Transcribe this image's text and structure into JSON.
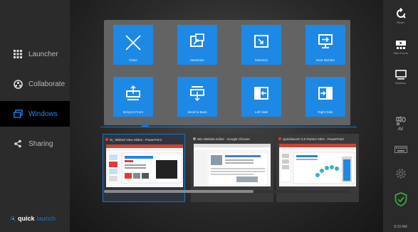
{
  "sidebar": {
    "items": [
      {
        "label": "Launcher",
        "icon": "grid-icon"
      },
      {
        "label": "Collaborate",
        "icon": "collaborate-icon"
      },
      {
        "label": "Windows",
        "icon": "windows-icon",
        "active": true
      },
      {
        "label": "Sharing",
        "icon": "share-icon"
      }
    ],
    "logo_a": "quick",
    "logo_b": "launch"
  },
  "actions": [
    {
      "label": "Close",
      "icon": "close-x-icon"
    },
    {
      "label": "Maximize",
      "icon": "maximize-icon"
    },
    {
      "label": "Minimize",
      "icon": "minimize-icon"
    },
    {
      "label": "Next Monitor",
      "icon": "next-monitor-icon"
    },
    {
      "label": "Bring to Front",
      "icon": "bring-front-icon"
    },
    {
      "label": "Send to Back",
      "icon": "send-back-icon"
    },
    {
      "label": "Left Side",
      "icon": "left-side-icon"
    },
    {
      "label": "Right Side",
      "icon": "right-side-icon"
    }
  ],
  "windows": [
    {
      "title": "SI_Tabbed View Slides - PowerPoint",
      "dot_color": "#e53935",
      "selected": true
    },
    {
      "title": "Wix Website Editor - Google Chrome",
      "dot_color": "#9e9e9e",
      "selected": false
    },
    {
      "title": "Quicklaunch 3.0 Partner NDA - PowerPoint",
      "dot_color": "#e53935",
      "selected": false
    }
  ],
  "scroll": {
    "position": 0.0,
    "visible_fraction": 0.6
  },
  "rightbar": {
    "reset_label": "Reset",
    "start_label": "Start Focus",
    "desktop_label": "Desktop",
    "av_label": "AV",
    "time": "8:10 AM"
  },
  "colors": {
    "accent": "#1e88e5",
    "secure": "#3aa63a"
  }
}
